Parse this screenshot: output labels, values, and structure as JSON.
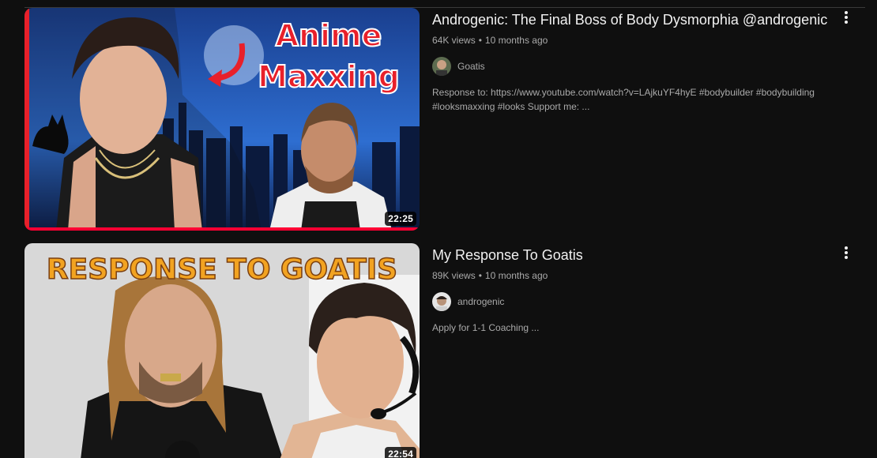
{
  "results": [
    {
      "title": "Androgenic: The Final Boss of Body Dysmorphia @androgenic",
      "views": "64K views",
      "age": "10 months ago",
      "channel": "Goatis",
      "description": "Response to: https://www.youtube.com/watch?v=LAjkuYF4hyE #bodybuilder #bodybuilding #looksmaxxing #looks Support me: ...",
      "duration": "22:25",
      "watch_progress_fraction": 1.0,
      "thumb_text": [
        "Anime",
        "Maxxing"
      ]
    },
    {
      "title": "My Response To Goatis",
      "views": "89K views",
      "age": "10 months ago",
      "channel": "androgenic",
      "description": "Apply for 1-1 Coaching ...",
      "duration": "22:54",
      "watch_progress_fraction": 0,
      "thumb_text": [
        "RESPONSE TO GOATIS"
      ]
    }
  ],
  "meta_separator": "•",
  "colors": {
    "background": "#0f0f0f",
    "accent": "#ff0033",
    "secondary_text": "#aaaaaa"
  }
}
